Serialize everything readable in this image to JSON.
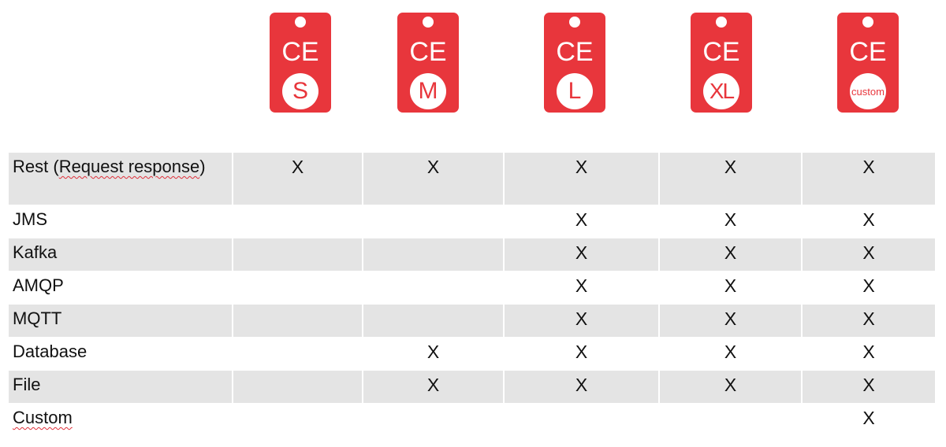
{
  "brand_color": "#e8363c",
  "row_shade_color": "#e4e4e4",
  "badges": [
    {
      "prefix": "CE",
      "size": "S"
    },
    {
      "prefix": "CE",
      "size": "M"
    },
    {
      "prefix": "CE",
      "size": "L"
    },
    {
      "prefix": "CE",
      "size": "XL"
    },
    {
      "prefix": "CE",
      "size": "custom"
    }
  ],
  "table": {
    "mark": "X",
    "rows": [
      {
        "label_pre": "Rest (",
        "label_flag": "Request response",
        "label_post": ")",
        "cells": [
          "X",
          "X",
          "X",
          "X",
          "X"
        ]
      },
      {
        "label": "JMS",
        "cells": [
          "",
          "",
          "X",
          "X",
          "X"
        ]
      },
      {
        "label": "Kafka",
        "cells": [
          "",
          "",
          "X",
          "X",
          "X"
        ]
      },
      {
        "label": "AMQP",
        "cells": [
          "",
          "",
          "X",
          "X",
          "X"
        ]
      },
      {
        "label": "MQTT",
        "cells": [
          "",
          "",
          "X",
          "X",
          "X"
        ]
      },
      {
        "label": "Database",
        "cells": [
          "",
          "X",
          "X",
          "X",
          "X"
        ]
      },
      {
        "label": "File",
        "cells": [
          "",
          "X",
          "X",
          "X",
          "X"
        ]
      },
      {
        "label_flag": "Custom",
        "cells": [
          "",
          "",
          "",
          "",
          "X"
        ]
      }
    ]
  }
}
